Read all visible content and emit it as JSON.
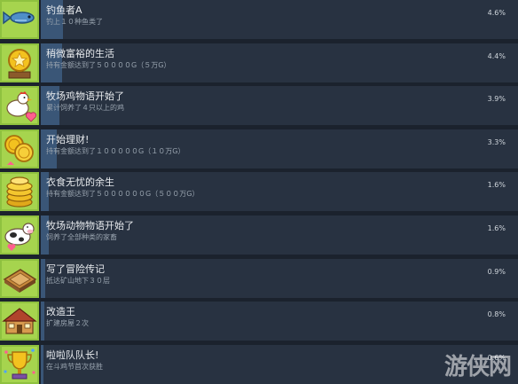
{
  "achievements": [
    {
      "title": "钓鱼者A",
      "description": "钓上１０种鱼类了",
      "percent": "4.6%",
      "icon": "fish-icon"
    },
    {
      "title": "稍微富裕的生活",
      "description": "持有金额达到了５００００G（５万G）",
      "percent": "4.4%",
      "icon": "gold-coin-icon"
    },
    {
      "title": "牧场鸡物语开始了",
      "description": "累计饲养了４只以上的鸡",
      "percent": "3.9%",
      "icon": "chicken-icon"
    },
    {
      "title": "开始理财!",
      "description": "持有金额达到了１０００００G（１０万G）",
      "percent": "3.3%",
      "icon": "coins-icon"
    },
    {
      "title": "衣食无忧的余生",
      "description": "持有金额达到了５００００００G（５００万G）",
      "percent": "1.6%",
      "icon": "coin-stack-icon"
    },
    {
      "title": "牧场动物物语开始了",
      "description": "饲养了全部种类的家畜",
      "percent": "1.6%",
      "icon": "cow-icon"
    },
    {
      "title": "写了冒险传记",
      "description": "抵达矿山地下３０层",
      "percent": "0.9%",
      "icon": "map-board-icon"
    },
    {
      "title": "改造王",
      "description": "扩建房屋２次",
      "percent": "0.8%",
      "icon": "house-icon"
    },
    {
      "title": "啦啦队队长!",
      "description": "在斗鸡节首次获胜",
      "percent": "0.6%",
      "icon": "trophy-icon"
    }
  ],
  "colors": {
    "background": "#1b222d",
    "row": "#283241",
    "progress_fill": "#3a5677",
    "icon_bg": "#8fc13f"
  },
  "watermark": {
    "text": "游侠网"
  }
}
